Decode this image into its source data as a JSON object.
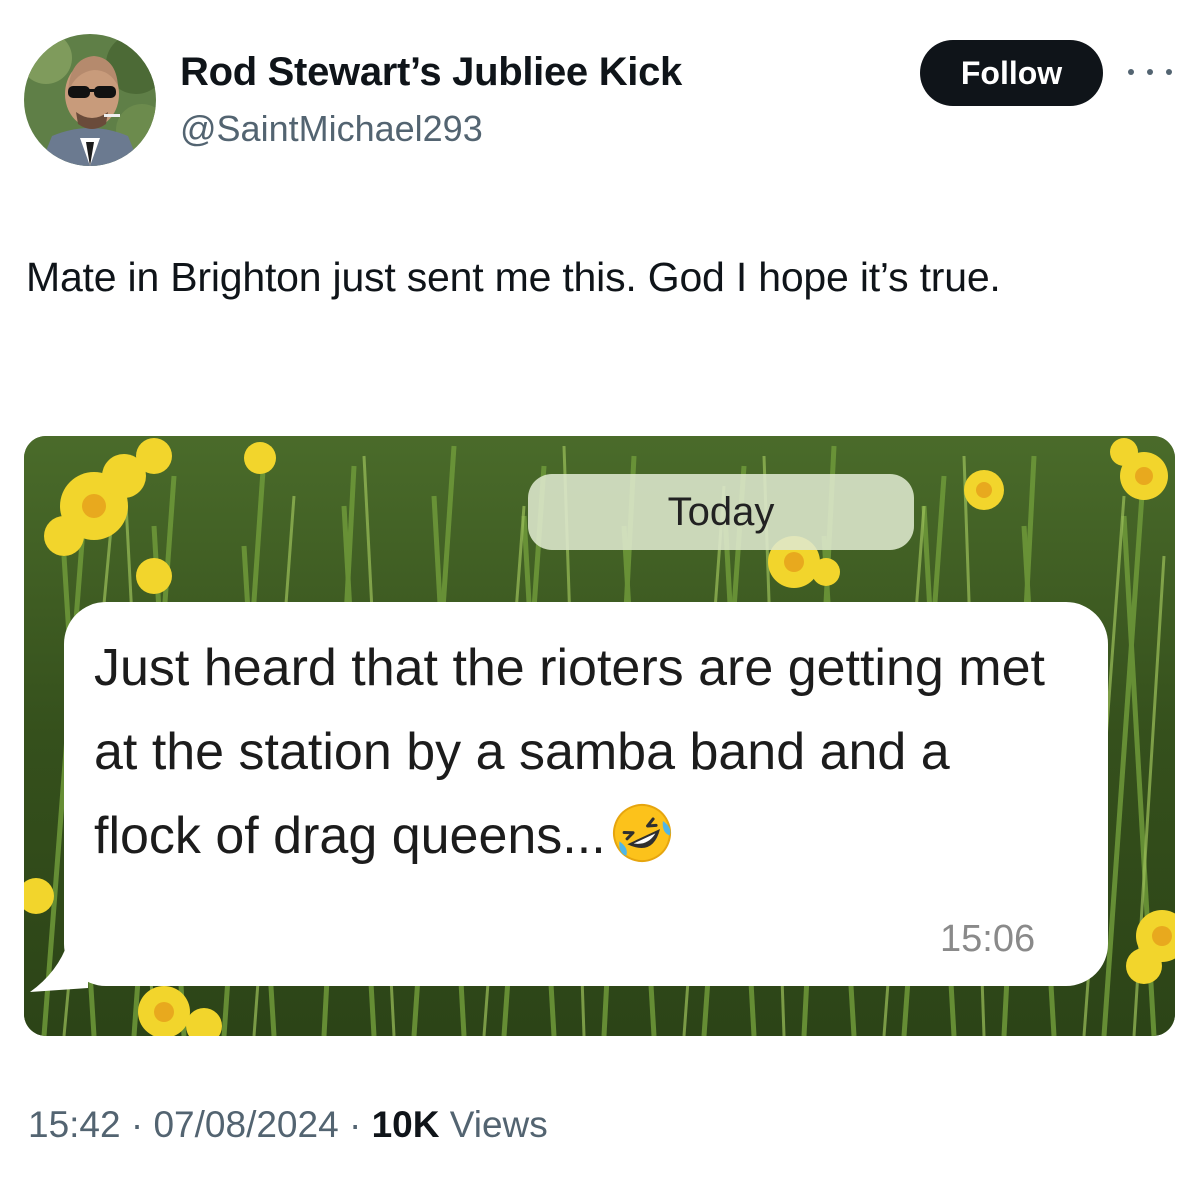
{
  "author": {
    "display_name": "Rod Stewart’s Jubliee Kick",
    "handle": "@SaintMichael293"
  },
  "actions": {
    "follow_label": "Follow",
    "more_icon": "more-horizontal-icon"
  },
  "tweet": {
    "text": "Mate in Brighton just sent me this. God I hope it’s true."
  },
  "media": {
    "date_label": "Today",
    "message": "Just heard that the rioters are getting met at the station by a samba band and a flock of drag queens...",
    "emoji": "rolling-on-floor-laughing-emoji",
    "message_time": "15:06"
  },
  "meta": {
    "time": "15:42",
    "separator": " · ",
    "date": "07/08/2024",
    "views_count": "10K",
    "views_label": " Views"
  },
  "colors": {
    "follow_bg": "#0f1419",
    "secondary_text": "#536471",
    "bubble_bg": "#ffffff",
    "daffodil": "#f2d52c",
    "foliage": "#3f5a22"
  }
}
